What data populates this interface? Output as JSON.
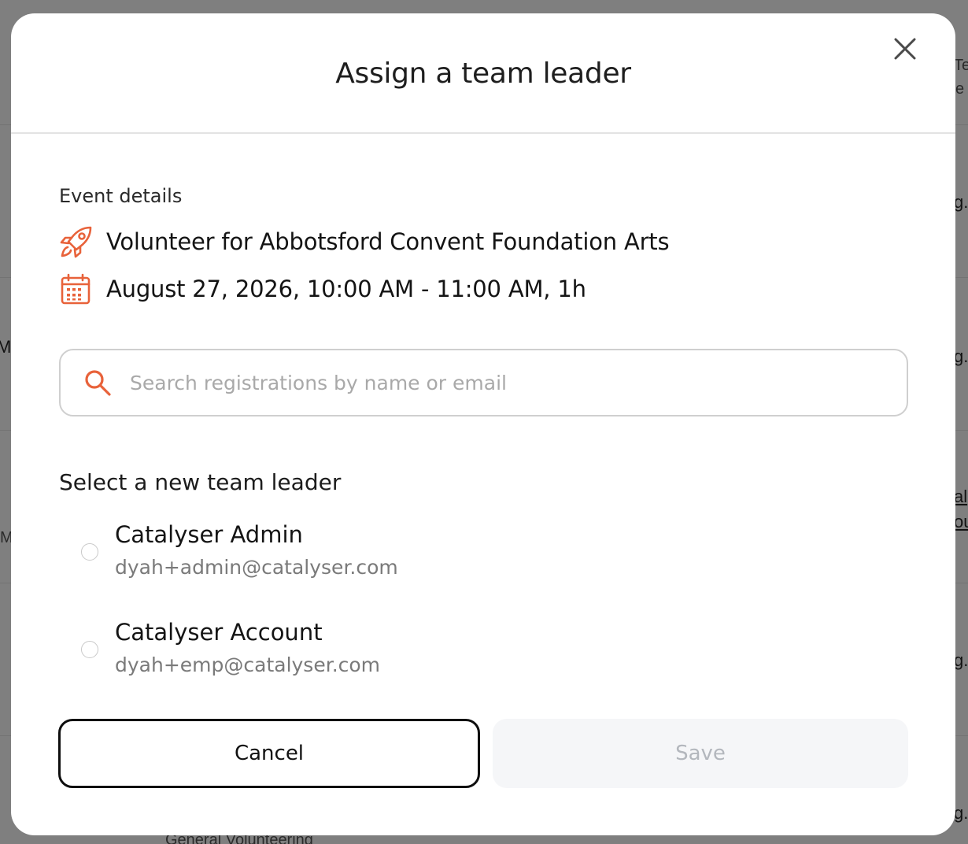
{
  "background": {
    "fragments": [
      "Te",
      "e",
      "g.",
      "M",
      "g.",
      "al",
      "ou",
      "M",
      "g.",
      "g.",
      "General Volunteering"
    ]
  },
  "modal": {
    "title": "Assign a team leader",
    "close_icon": "close-icon",
    "event_details": {
      "label": "Event details",
      "event_name": "Volunteer for Abbotsford Convent Foundation Arts",
      "event_icon": "rocket-icon",
      "datetime": "August 27, 2026, 10:00 AM - 11:00 AM, 1h",
      "datetime_icon": "calendar-icon"
    },
    "search": {
      "placeholder": "Search registrations by name or email",
      "value": "",
      "icon": "search-icon"
    },
    "select_heading": "Select a new team leader",
    "candidates": [
      {
        "name": "Catalyser Admin",
        "email": "dyah+admin@catalyser.com",
        "selected": false
      },
      {
        "name": "Catalyser Account",
        "email": "dyah+emp@catalyser.com",
        "selected": false
      }
    ],
    "buttons": {
      "cancel_label": "Cancel",
      "save_label": "Save"
    },
    "colors": {
      "accent": "#e8623a",
      "overlay": "#7f7f7f",
      "save_disabled_bg": "#f5f6f8",
      "save_disabled_text": "#b3b7bd"
    }
  }
}
